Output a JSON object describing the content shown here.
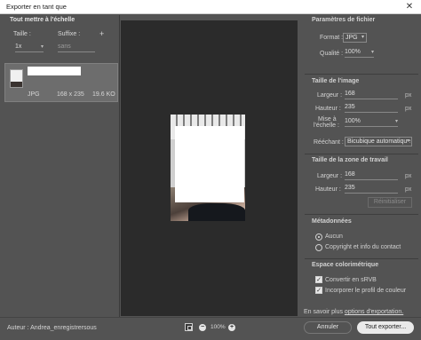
{
  "window": {
    "title": "Exporter en tant que",
    "close_symbol": "✕"
  },
  "left": {
    "header": "Tout mettre à l'échelle",
    "size_label": "Taille :",
    "suffix_label": "Suffixe :",
    "add_symbol": "+",
    "scale_value": "1x",
    "suffix_placeholder": "sans",
    "item": {
      "format": "JPG",
      "dimensions": "168 x 235",
      "filesize": "19.6 KO"
    }
  },
  "zoom": {
    "minus": "−",
    "plus": "+",
    "value": "100%"
  },
  "right": {
    "file_params": {
      "header": "Paramètres de fichier",
      "format_label": "Format :",
      "format_value": "JPG",
      "quality_label": "Qualité :",
      "quality_value": "100%"
    },
    "image_size": {
      "header": "Taille de l'image",
      "width_label": "Largeur :",
      "width_value": "168",
      "height_label": "Hauteur :",
      "height_value": "235",
      "scale_label_1": "Mise à",
      "scale_label_2": "l'échelle :",
      "scale_value": "100%",
      "resample_label": "Rééchant :",
      "resample_value": "Bicubique automatique",
      "unit": "px"
    },
    "canvas_size": {
      "header": "Taille de la zone de travail",
      "width_label": "Largeur :",
      "width_value": "168",
      "height_label": "Hauteur :",
      "height_value": "235",
      "unit": "px",
      "reset_label": "Réinitialiser"
    },
    "metadata": {
      "header": "Métadonnées",
      "option_none": "Aucun",
      "option_copyright": "Copyright et info du contact"
    },
    "color_space": {
      "header": "Espace colorimétrique",
      "convert_label": "Convertir en sRVB",
      "profile_label": "Incorporer le profil de couleur"
    },
    "learn_more_prefix": "En savoir plus",
    "learn_more_link": "options d'exportation."
  },
  "footer": {
    "author": "Auteur : Andrea_enregistrersous",
    "cancel_label": "Annuler",
    "export_label": "Tout exporter..."
  }
}
